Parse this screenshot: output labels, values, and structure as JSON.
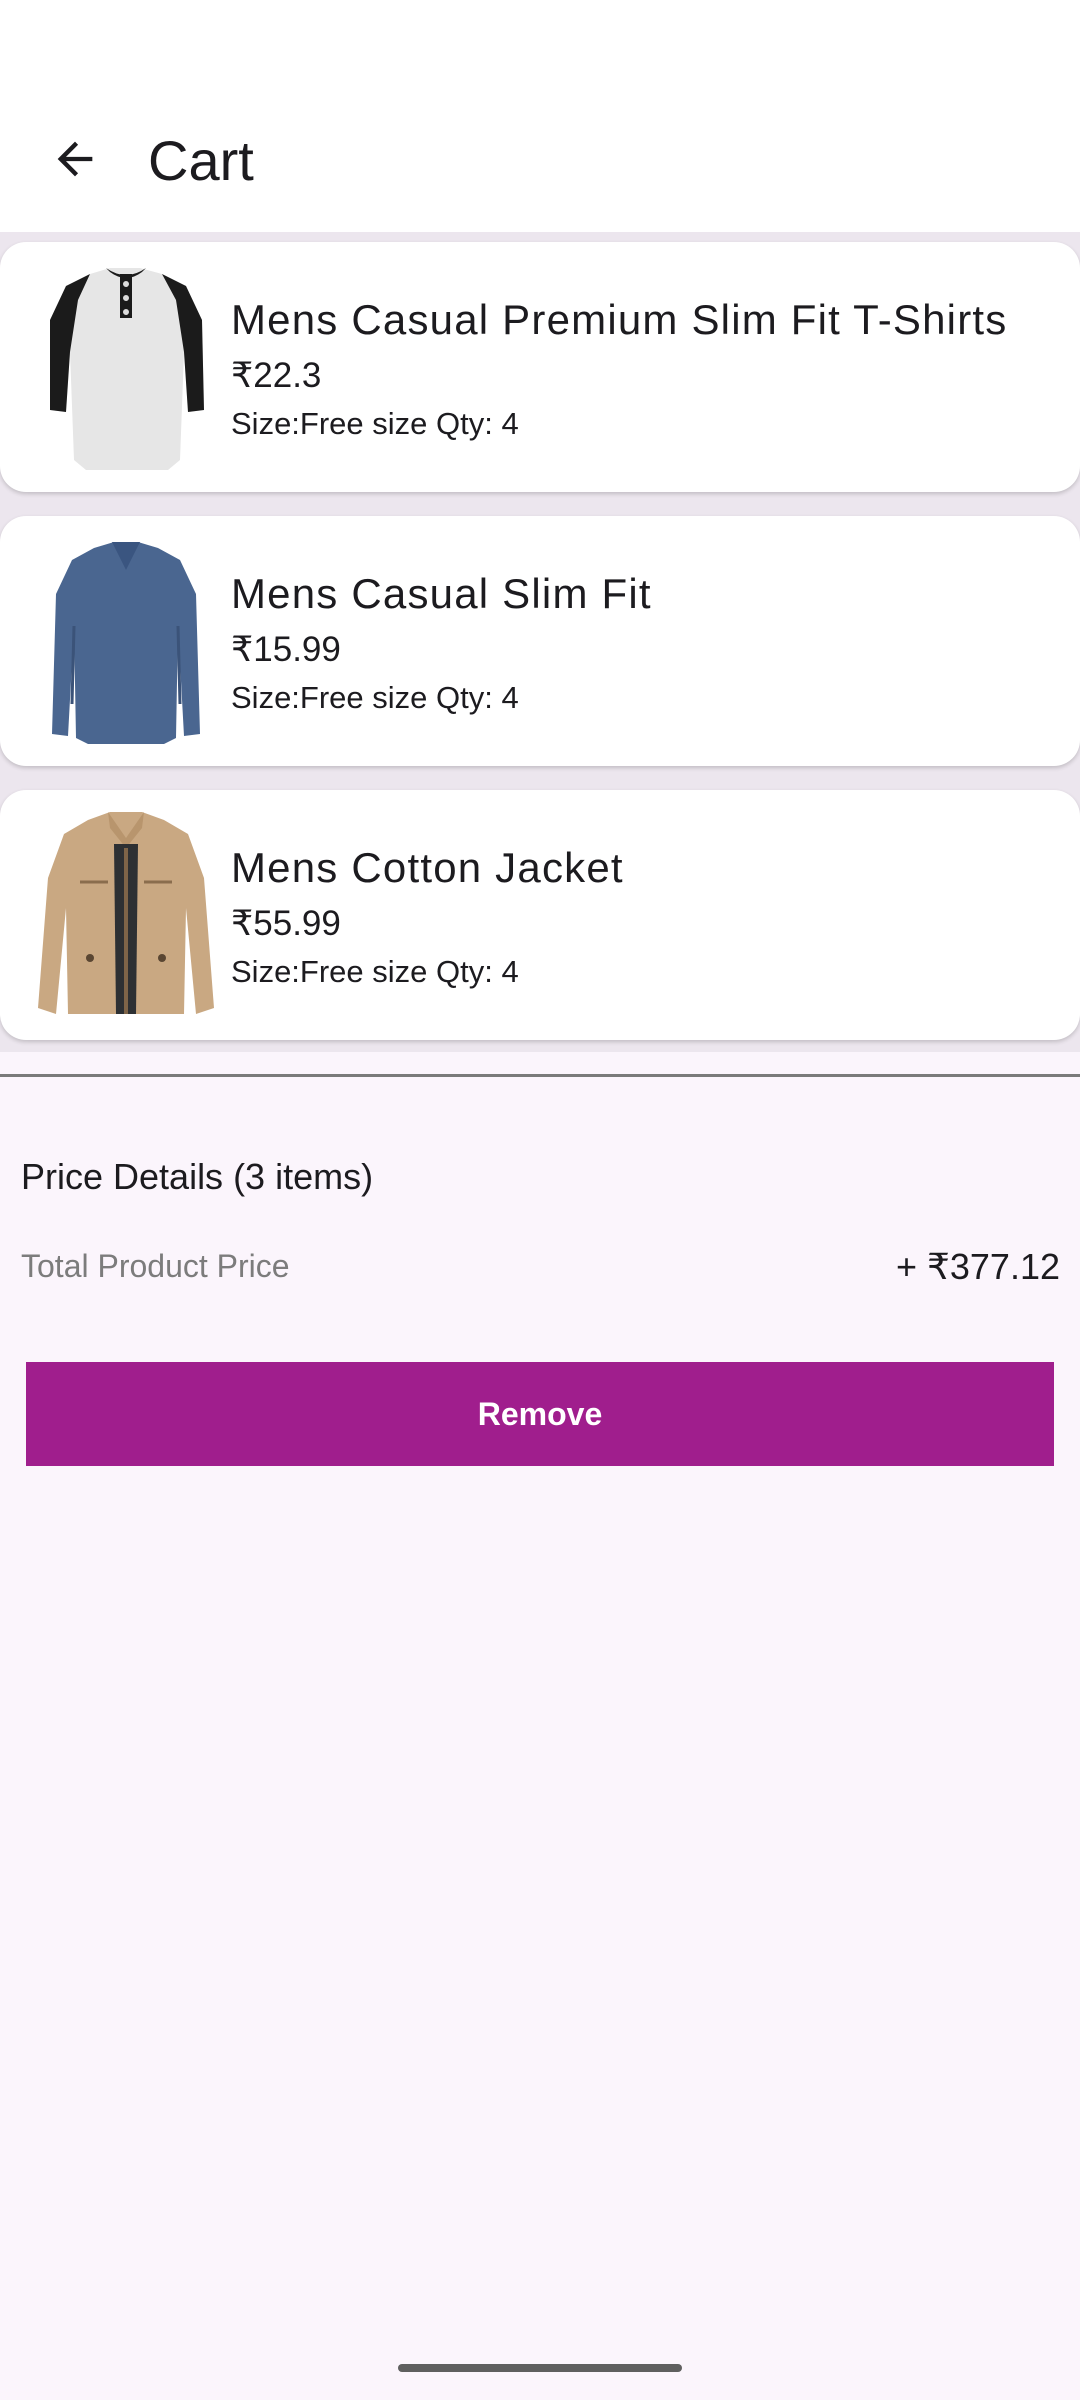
{
  "app_bar": {
    "title": "Cart",
    "back_icon": "arrow-left-icon"
  },
  "cart": {
    "items": [
      {
        "name": "Mens Casual Premium Slim Fit T-Shirts",
        "price": "₹22.3",
        "meta": "Size:Free size  Qty: 4",
        "image": "raglan-henley-tshirt-image"
      },
      {
        "name": "Mens Casual Slim Fit",
        "price": "₹15.99",
        "meta": "Size:Free size  Qty: 4",
        "image": "blue-longsleeve-tshirt-image"
      },
      {
        "name": "Mens Cotton Jacket",
        "price": "₹55.99",
        "meta": "Size:Free size  Qty: 4",
        "image": "khaki-cotton-jacket-image"
      }
    ]
  },
  "summary": {
    "title": "Price Details (3 items)",
    "total_label": "Total Product Price",
    "total_value": "+ ₹377.12"
  },
  "actions": {
    "remove_label": "Remove"
  },
  "colors": {
    "accent": "#a01e8d",
    "background": "#fbf5fc",
    "list_background": "#ece6ee"
  }
}
